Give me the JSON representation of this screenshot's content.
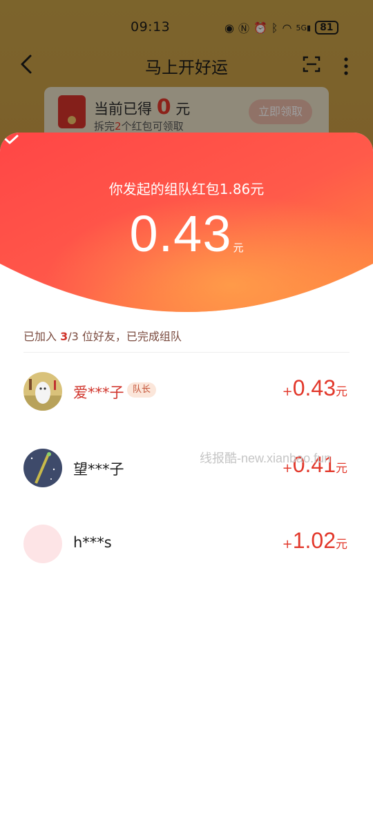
{
  "status_bar": {
    "time": "09:13",
    "icons": [
      "eye-icon",
      "nfc-icon",
      "alarm-icon",
      "bluetooth-icon",
      "wifi-icon",
      "signal-5g-icon"
    ],
    "battery": "81"
  },
  "nav": {
    "title": "马上开好运",
    "back_icon": "chevron-left-icon",
    "scan_icon": "scan-icon",
    "more_icon": "more-vertical-icon"
  },
  "earn_card": {
    "title_prefix": "当前已得",
    "amount": "0",
    "unit": "元",
    "sub_prefix": "拆完",
    "sub_count": "2",
    "sub_suffix": "个红包可领取",
    "button": "立即领取"
  },
  "sheet": {
    "collapse_icon": "chevron-down-icon",
    "total_text": "你发起的组队红包1.86元",
    "amount": "0.43",
    "amount_unit": "元",
    "team_status_prefix": "已加入 ",
    "team_status_count": "3",
    "team_status_suffix": "/3 位好友，已完成组队",
    "members": [
      {
        "name": "爱***子",
        "badge": "队长",
        "amount": "0.43",
        "sign": "+",
        "unit": "元"
      },
      {
        "name": "望***子",
        "badge": "",
        "amount": "0.41",
        "sign": "+",
        "unit": "元"
      },
      {
        "name": "h***s",
        "badge": "",
        "amount": "1.02",
        "sign": "+",
        "unit": "元"
      }
    ]
  },
  "watermark": "线报酷-new.xianbao.fun",
  "colors": {
    "accent_red": "#e2382b",
    "header_gradient_start": "#ff4a4a",
    "header_gradient_end": "#ff8a3c"
  }
}
